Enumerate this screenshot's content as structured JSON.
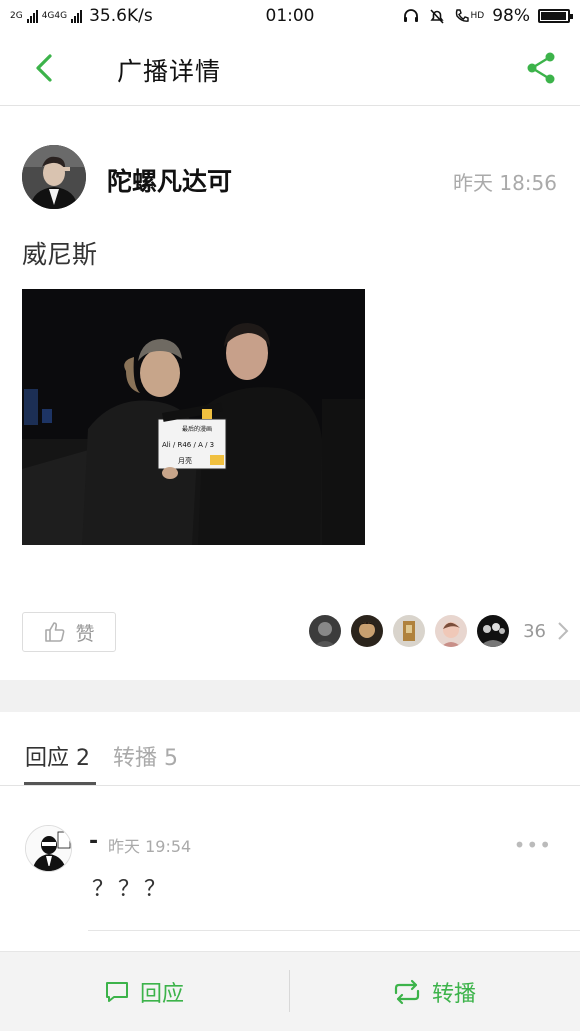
{
  "status_bar": {
    "network_1": "2G",
    "network_2": "4G4G",
    "speed": "35.6K/s",
    "time": "01:00",
    "hd_label": "HD",
    "battery": "98%"
  },
  "nav": {
    "title": "广播详情",
    "back_icon": "chevron-left-icon",
    "share_icon": "share-icon",
    "accent_color": "#3cb34a"
  },
  "post": {
    "author": "陀螺凡达可",
    "time": "昨天 18:56",
    "text": "威尼斯",
    "like_label": "赞",
    "like_count": "36",
    "photo_clapper_lines": [
      "最后的漫画",
      "Ali / R46 / A / 3",
      "月亮"
    ]
  },
  "tabs": {
    "replies": "回应 2",
    "reposts": "转播 5"
  },
  "comment": {
    "author": "-",
    "time": "昨天 19:54",
    "more": "•••",
    "text": "？？？"
  },
  "bottom_bar": {
    "reply_label": "回应",
    "repost_label": "转播"
  }
}
